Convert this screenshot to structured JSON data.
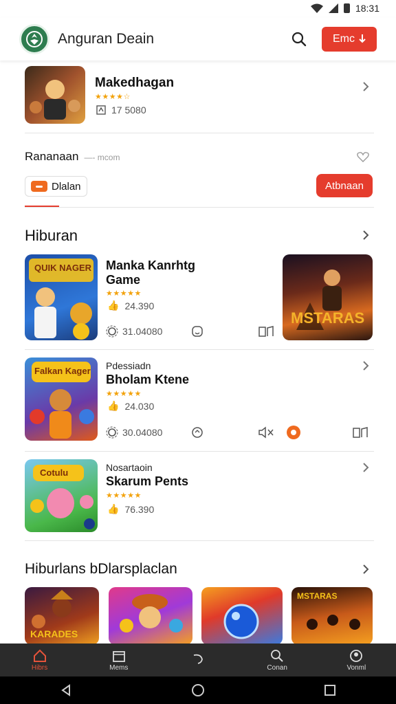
{
  "status": {
    "time": "18:31"
  },
  "appbar": {
    "title": "Anguran Deain",
    "button_label": "Emc"
  },
  "featured": {
    "title": "Makedhagan",
    "rating": "★★★★☆",
    "count": "17 5080"
  },
  "promo": {
    "label": "Rananaan",
    "sublabel": "—- mcom",
    "chip_label": "Dlalan",
    "action_label": "Atbnaan"
  },
  "section1": {
    "title": "Hiburan",
    "items": [
      {
        "art_text": "QUIK NAGER",
        "small": "",
        "name": "Manka Kanrhtg Game",
        "rating": "★★★★★",
        "score": "24.390",
        "meta1": "31.04080",
        "side_art": "MSTARAS"
      },
      {
        "art_text": "Falkan Kager",
        "small": "Pdessiadn",
        "name": "Bholam Ktene",
        "rating": "★★★★★",
        "score": "24.030",
        "meta1": "30.04080"
      },
      {
        "art_text": "Cotulu",
        "small": "Nosartaoin",
        "name": "Skarum Pents",
        "rating": "★★★★★",
        "score": "76.390",
        "meta1": ""
      }
    ]
  },
  "section2": {
    "title": "Hiburlans bDlarsplaclan",
    "items": [
      {
        "art_text": "KARADES"
      },
      {
        "art_text": ""
      },
      {
        "art_text": ""
      },
      {
        "art_text": "MSTARAS"
      }
    ]
  },
  "bottom_nav": [
    {
      "label": "Hibrs",
      "active": true
    },
    {
      "label": "Mems",
      "active": false
    },
    {
      "label": "",
      "active": false
    },
    {
      "label": "Conan",
      "active": false
    },
    {
      "label": "Vonml",
      "active": false
    }
  ],
  "colors": {
    "accent": "#e53c2d",
    "brand": "#2e7d4f",
    "nav_bg": "#2b2b2b",
    "star": "#f2a20c"
  }
}
